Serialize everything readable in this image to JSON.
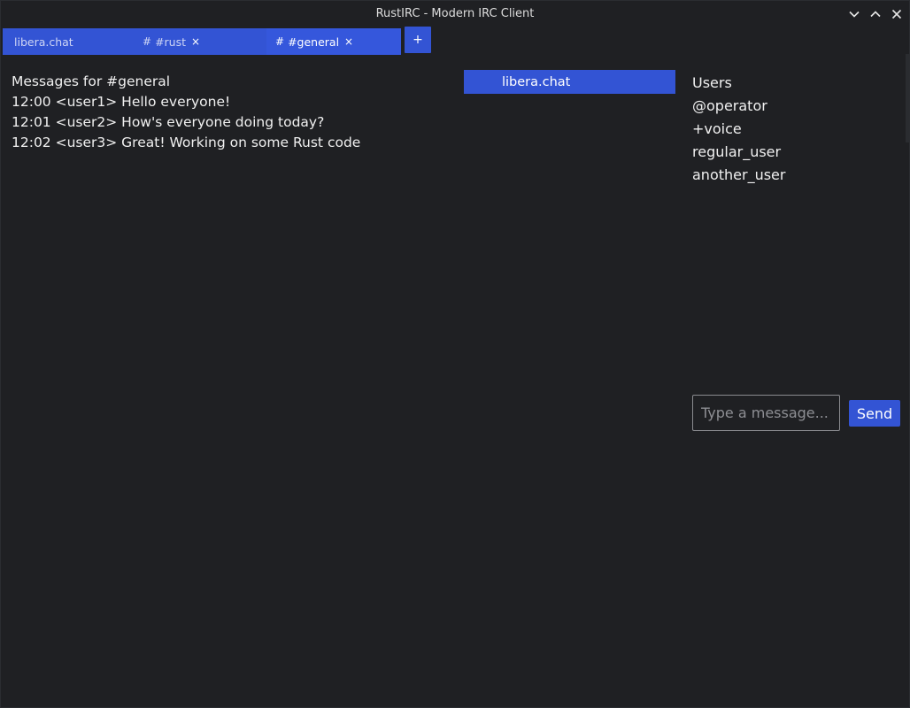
{
  "window": {
    "title": "RustIRC - Modern IRC Client"
  },
  "tabs": [
    {
      "glyph": "",
      "label": "libera.chat",
      "closable": false,
      "active": false
    },
    {
      "glyph": "#",
      "label": "#rust",
      "closable": true,
      "active": false
    },
    {
      "glyph": "#",
      "label": "#general",
      "closable": true,
      "active": true
    }
  ],
  "tab_close_glyph": "×",
  "new_tab_label": "+",
  "messages": {
    "heading": "Messages for #general",
    "lines": [
      "12:00 <user1> Hello everyone!",
      "12:01 <user2> How's everyone doing today?",
      "12:02 <user3> Great! Working on some Rust code"
    ]
  },
  "server_tree": {
    "expander_glyph": "",
    "server_glyph": "",
    "label": "libera.chat"
  },
  "users": {
    "heading": "Users",
    "list": [
      "@operator",
      "+voice",
      "regular_user",
      "another_user"
    ]
  },
  "input": {
    "placeholder": "Type a message...",
    "value": "",
    "send_label": "Send"
  },
  "colors": {
    "accent": "#3354d4",
    "background": "#1f2023"
  },
  "icons": {
    "minimize": "chevron-down-icon",
    "maximize": "chevron-up-icon",
    "close": "close-icon"
  }
}
